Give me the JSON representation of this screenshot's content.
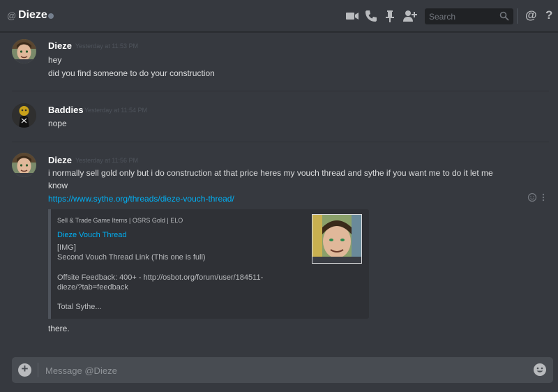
{
  "header": {
    "at_symbol": "@",
    "dm_name": "Dieze",
    "search": {
      "placeholder": "Search"
    },
    "icons": [
      "video-call-icon",
      "voice-call-icon",
      "pin-icon",
      "add-friend-icon",
      "search-icon",
      "mention-icon",
      "help-icon"
    ],
    "mention_label": "@",
    "help_label": "?"
  },
  "messages": [
    {
      "author": "Dieze",
      "timestamp": "Yesterday at 11:53 PM",
      "lines": [
        "hey",
        "did you find someone to do your construction"
      ]
    },
    {
      "author": "Baddies",
      "timestamp": "Yesterday at 11:54 PM",
      "lines": [
        "nope"
      ]
    },
    {
      "author": "Dieze",
      "timestamp": "Yesterday at 11:56 PM",
      "lines": [
        "i normally sell gold only but i do construction at that price heres my vouch thread and sythe if you want me to do it let me",
        "know"
      ],
      "link": "https://www.sythe.org/threads/dieze-vouch-thread/",
      "embed": {
        "provider": "Sell & Trade Game Items | OSRS Gold | ELO",
        "title": "Dieze Vouch Thread",
        "description": [
          "[IMG]",
          "Second Vouch Thread Link (This one is full)",
          "",
          "Offsite Feedback: 400+ - http://osbot.org/forum/user/184511-",
          "dieze/?tab=feedback",
          "",
          "Total Sythe..."
        ]
      },
      "after": "there."
    }
  ],
  "composer": {
    "placeholder": "Message @Dieze"
  },
  "colors": {
    "background": "#36393f",
    "link": "#00b0f4",
    "embed_bg": "#2f3136",
    "composer_bg": "#484c52"
  }
}
